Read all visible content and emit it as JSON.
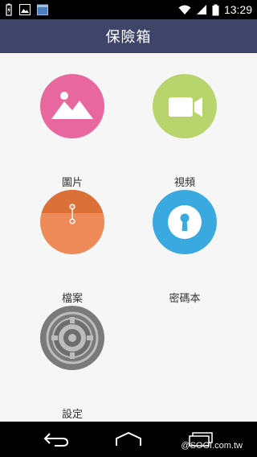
{
  "status_bar": {
    "time": "13:29",
    "icons": [
      "battery-charging-icon",
      "image-icon",
      "calendar-icon",
      "wifi-icon",
      "signal-icon",
      "battery-icon"
    ]
  },
  "app_bar": {
    "title": "保險箱"
  },
  "tiles": [
    {
      "label": "圖片",
      "icon": "image-icon",
      "color": "#e8679e"
    },
    {
      "label": "視頻",
      "icon": "video-camera-icon",
      "color": "#b8d46c"
    },
    {
      "label": "檔案",
      "icon": "folder-icon",
      "color": "#ee8a57"
    },
    {
      "label": "密碼本",
      "icon": "keyhole-icon",
      "color": "#3aa9e0"
    },
    {
      "label": "設定",
      "icon": "safe-dial-icon",
      "color": "#7a7a7a"
    }
  ],
  "nav_bar": {
    "icons": [
      "back-icon",
      "home-icon",
      "recent-apps-icon"
    ]
  },
  "watermark": "@SOGI.com.tw"
}
